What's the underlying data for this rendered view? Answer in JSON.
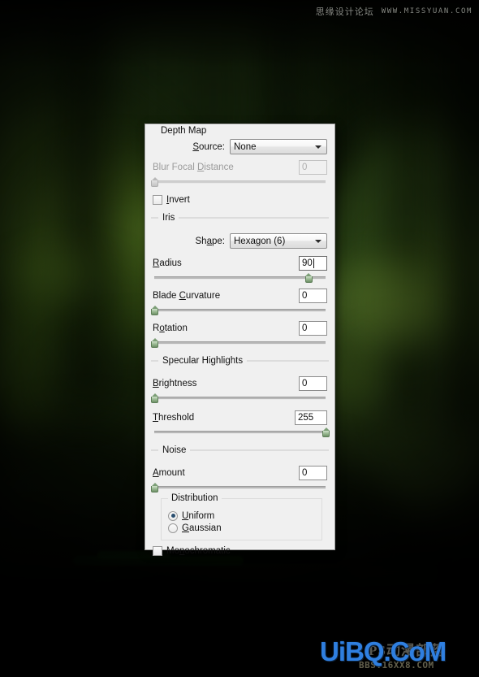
{
  "watermark": {
    "top_cn": "思缘设计论坛",
    "top_url": "WWW.MISSYUAN.COM",
    "bottom_main": "UiBQ.CoM",
    "bottom_ps": "PS动漫部落",
    "bottom_bbs": "BBS.16XX8.COM"
  },
  "dialog": {
    "sections": {
      "depth_map": {
        "legend": "Depth Map",
        "source_label": "Source:",
        "source_value": "None",
        "source_options": [
          "None"
        ],
        "blur_focal_label": "Blur Focal Distance",
        "blur_focal_value": "0",
        "blur_focal_percent": 0,
        "invert_label": "Invert",
        "invert_checked": false
      },
      "iris": {
        "legend": "Iris",
        "shape_label": "Shape:",
        "shape_value": "Hexagon (6)",
        "shape_options": [
          "Hexagon (6)"
        ],
        "radius_label": "Radius",
        "radius_value": "90",
        "radius_percent": 90,
        "blade_curvature_label": "Blade Curvature",
        "blade_curvature_value": "0",
        "blade_curvature_percent": 0,
        "rotation_label": "Rotation",
        "rotation_value": "0",
        "rotation_percent": 0
      },
      "specular": {
        "legend": "Specular Highlights",
        "brightness_label": "Brightness",
        "brightness_value": "0",
        "brightness_percent": 0,
        "threshold_label": "Threshold",
        "threshold_value": "255",
        "threshold_percent": 100
      },
      "noise": {
        "legend": "Noise",
        "amount_label": "Amount",
        "amount_value": "0",
        "amount_percent": 0,
        "distribution_legend": "Distribution",
        "uniform_label": "Uniform",
        "gaussian_label": "Gaussian",
        "distribution_selected": "Uniform",
        "monochromatic_label": "Monochromatic",
        "monochromatic_checked": false
      }
    }
  },
  "colors": {
    "dialog_bg": "#f0f0f0",
    "handle_green": "#7c9e76",
    "radio_dot": "#2a4f70",
    "watermark_blue": "#2f7fe0"
  }
}
